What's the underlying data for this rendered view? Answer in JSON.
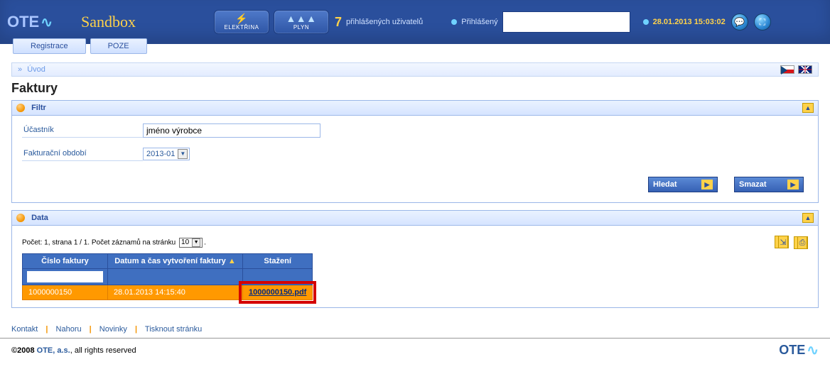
{
  "header": {
    "logo_text": "OTE",
    "sandbox": "Sandbox",
    "tab_electricity": "ELEKTŘINA",
    "tab_gas": "PLYN",
    "users_count": "7",
    "users_label": "přihlášených uživatelů",
    "logged_label": "Přihlášený",
    "datetime": "28.01.2013 15:03:02",
    "nav_register": "Registrace",
    "nav_poze": "POZE"
  },
  "breadcrumb": {
    "prefix": "»",
    "home": "Úvod"
  },
  "page": {
    "title": "Faktury",
    "filter_heading": "Filtr",
    "participant_label": "Účastník",
    "participant_value": "jméno výrobce",
    "period_label": "Fakturační období",
    "period_value": "2013-01",
    "btn_search": "Hledat",
    "btn_clear": "Smazat",
    "data_heading": "Data",
    "pager_text_1": "Počet: 1, strana 1 / 1. Počet záznamů na stránku",
    "page_size": "10",
    "columns": {
      "c0": "Číslo faktury",
      "c1": "Datum a čas vytvoření faktury",
      "c2": "Stažení"
    },
    "row": {
      "invoice_no": "1000000150",
      "created": "28.01.2013 14:15:40",
      "download": "1000000150.pdf"
    }
  },
  "footer": {
    "contact": "Kontakt",
    "top": "Nahoru",
    "news": "Novinky",
    "print": "Tisknout stránku",
    "copy_prefix": "©2008",
    "company": "OTE, a.s.",
    "copy_suffix": ", all rights reserved",
    "logo": "OTE"
  }
}
